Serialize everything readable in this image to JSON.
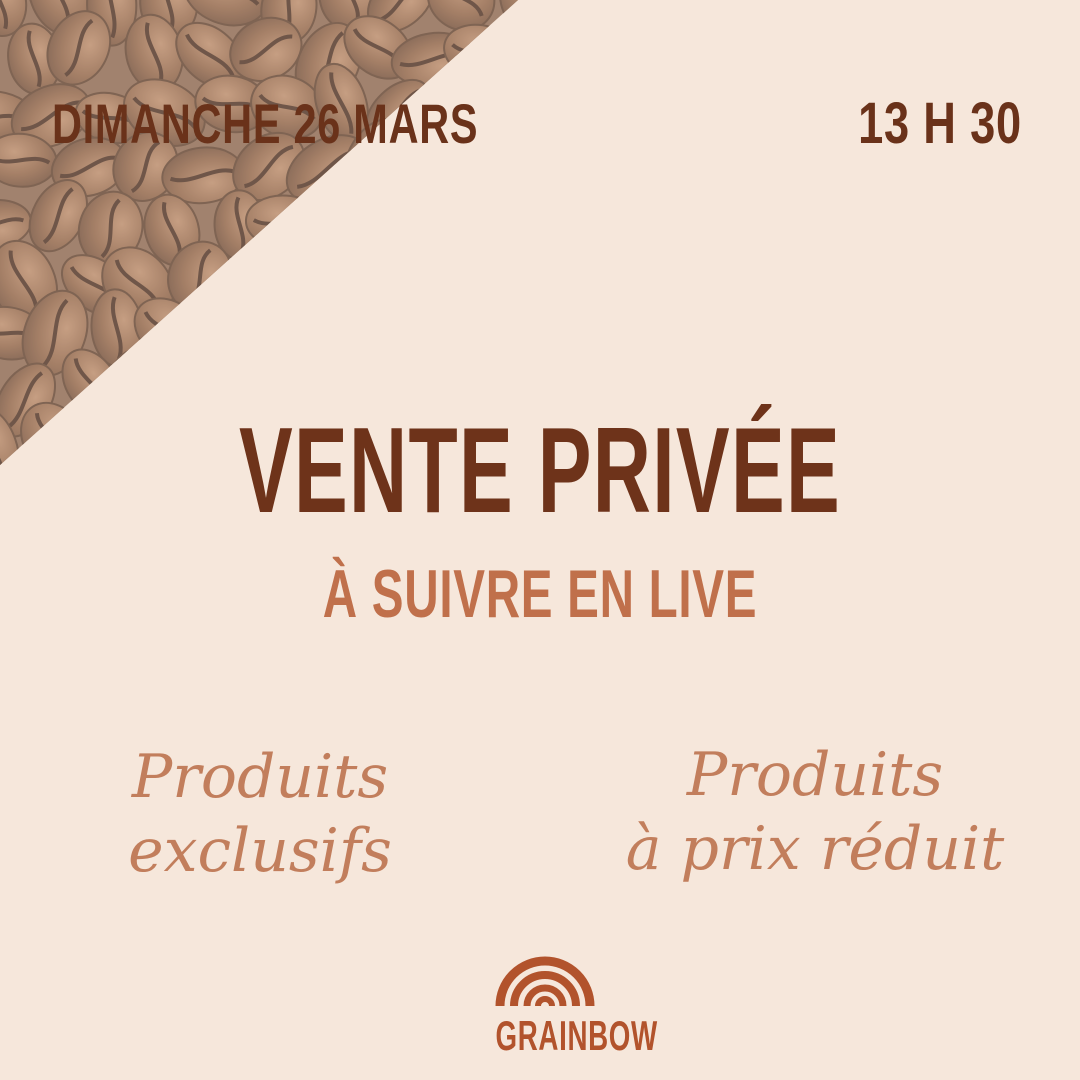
{
  "event": {
    "date": "DIMANCHE 26 MARS",
    "time": "13 H 30"
  },
  "headline": {
    "title": "VENTE PRIVÉE",
    "subtitle": "À SUIVRE EN LIVE"
  },
  "features": [
    {
      "text": "Produits\nexclusifs"
    },
    {
      "text": "Produits\nà prix réduit"
    }
  ],
  "brand": {
    "name": "GRAINBOW",
    "logo_icon": "rainbow-arches-icon"
  },
  "colors": {
    "background": "#f6e7db",
    "dark_brown": "#6a321a",
    "accent_terracotta": "#c0704b",
    "script_text": "#c27e5c",
    "brand": "#b2532c"
  }
}
